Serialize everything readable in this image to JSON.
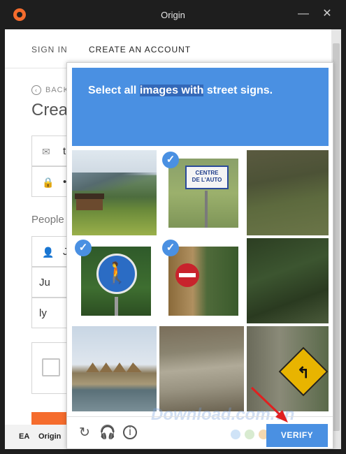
{
  "window": {
    "title": "Origin",
    "minimize_glyph": "—",
    "close_glyph": "✕"
  },
  "tabs": [
    {
      "label": "SIGN IN"
    },
    {
      "label": "CREATE AN ACCOUNT"
    }
  ],
  "form": {
    "back_label": "BACK",
    "title": "Crea",
    "email_value": "tr",
    "password_value": "••",
    "people_label": "People",
    "people_value": "Ju",
    "month_value": "Ju",
    "year_value": "ly"
  },
  "footer": {
    "ea_label": "EA",
    "origin_label": "Origin"
  },
  "captcha": {
    "instruction_pre": "Select all ",
    "instruction_hl": "images with",
    "instruction_mid": " ",
    "instruction_bold": "street signs.",
    "accent_color": "#4a90e2",
    "tiles": [
      {
        "subject": "mountain-village",
        "selected": false
      },
      {
        "subject": "centre-de-l-auto-sign",
        "selected": true,
        "sign_text": "CENTRE\nDE L'AUTO"
      },
      {
        "subject": "grass-bank",
        "selected": false
      },
      {
        "subject": "pedestrian-sign",
        "selected": true
      },
      {
        "subject": "no-entry-sign",
        "selected": true
      },
      {
        "subject": "dark-trees",
        "selected": false
      },
      {
        "subject": "lakeside-huts",
        "selected": false
      },
      {
        "subject": "concrete-wall",
        "selected": false
      },
      {
        "subject": "turn-arrow-sign",
        "selected": false
      }
    ],
    "verify_label": "VERIFY",
    "watermark": "Download.com.vn",
    "icons": [
      "reload-icon",
      "headphones-icon",
      "info-icon"
    ]
  }
}
